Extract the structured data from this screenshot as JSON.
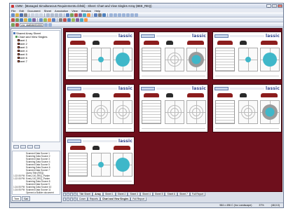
{
  "window": {
    "title": "CMM - [Managed Simultaneous Requirements.cbhsk] - Sheet: Chart and View Singles Array (BEE_REQ)",
    "controls": [
      "_",
      "□",
      "×"
    ]
  },
  "menu": [
    "File",
    "Edit",
    "Document",
    "Sheet",
    "Annotation",
    "View",
    "Window",
    "Help"
  ],
  "toolbar": {
    "input_value": "cnc_statInter01000.0"
  },
  "tree": {
    "items": [
      {
        "label": "Shared Array Sheet",
        "type": "root"
      },
      {
        "label": "Chart and View Singles",
        "type": "node"
      },
      {
        "label": "Sheet 1",
        "type": "sheet"
      },
      {
        "label": "Sheet 2",
        "type": "sheet"
      },
      {
        "label": "Sheet 3",
        "type": "sheet"
      },
      {
        "label": "Sheet 4",
        "type": "sheet"
      },
      {
        "label": "Sheet 5",
        "type": "sheet"
      },
      {
        "label": "Sheet 6",
        "type": "sheet"
      },
      {
        "label": "Sheet 7",
        "type": "sheet"
      }
    ]
  },
  "log": {
    "rows": [
      {
        "t": "",
        "m": "Scanned Data Source 1"
      },
      {
        "t": "",
        "m": "Scanning Data Source 2"
      },
      {
        "t": "",
        "m": "Scanned Data Source 3"
      },
      {
        "t": "",
        "m": "Scanning Data Source 4"
      },
      {
        "t": "",
        "m": "Scanned Data Source 5"
      },
      {
        "t": "",
        "m": "Scanning Data Source 6"
      },
      {
        "t": "",
        "m": "Scanned Data Source 7"
      },
      {
        "t": "",
        "m": "Query Title (REQ)"
      },
      {
        "t": "1:22:05 PM",
        "m": "Every 100_REQ_Parker"
      },
      {
        "t": "1:22:05 PM",
        "m": "Every 100_REQ_Parker"
      },
      {
        "t": "",
        "m": "Scanning Data Source 8"
      },
      {
        "t": "",
        "m": "Scanned Data Source 9"
      },
      {
        "t": "1:24:05 PM",
        "m": "Scanning Data Source 10"
      },
      {
        "t": "1:24:05 PM",
        "m": "Scanned Data Source 11"
      },
      {
        "t": "",
        "m": "Opened a Builder document"
      }
    ]
  },
  "left_tabs": [
    "Tree",
    "Sat"
  ],
  "sheet_logo": "lassic",
  "sheet_tabs_top": [
    "Title Sheet",
    "Array",
    "Sheet 1",
    "Sheet 2",
    "Sheet 3",
    "Sheet 4",
    "Sheet 5",
    "Sheet 6",
    "Sheet 7",
    "Full Report"
  ],
  "sheet_tabs_bottom": [
    "Cover",
    "Reports",
    "Chart and View Singles",
    "Full Report"
  ],
  "status": {
    "size": "984 x 496 C (Inc Landscape)",
    "zoom": "37%",
    "pos": "(48,0.0)"
  },
  "colors": {
    "workspace": "#6e0f1c",
    "accent_dot": "#3fb7c9",
    "logo": "#2b3f8a"
  }
}
